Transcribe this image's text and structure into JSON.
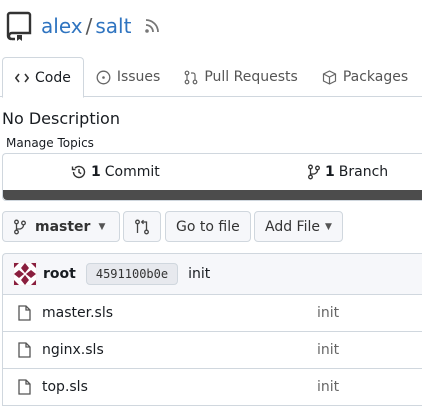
{
  "repo": {
    "owner": "alex",
    "separator": "/",
    "name": "salt"
  },
  "tabs": [
    {
      "label": "Code",
      "icon": "code-icon",
      "active": true
    },
    {
      "label": "Issues",
      "icon": "issue-icon",
      "active": false
    },
    {
      "label": "Pull Requests",
      "icon": "pull-request-icon",
      "active": false
    },
    {
      "label": "Packages",
      "icon": "package-icon",
      "active": false
    }
  ],
  "description": "No Description",
  "manage_topics": "Manage Topics",
  "stats": {
    "commits_count": "1",
    "commits_label": "Commit",
    "branches_count": "1",
    "branches_label": "Branch"
  },
  "toolbar": {
    "branch": "master",
    "go_to_file": "Go to file",
    "add_file": "Add File"
  },
  "latest_commit": {
    "author": "root",
    "sha": "4591100b0e",
    "message": "init"
  },
  "files": [
    {
      "name": "master.sls",
      "message": "init"
    },
    {
      "name": "nginx.sls",
      "message": "init"
    },
    {
      "name": "top.sls",
      "message": "init"
    }
  ],
  "colors": {
    "link": "#2f74c0",
    "border": "#d0d7de",
    "language_bar": "#4c4c4c"
  }
}
